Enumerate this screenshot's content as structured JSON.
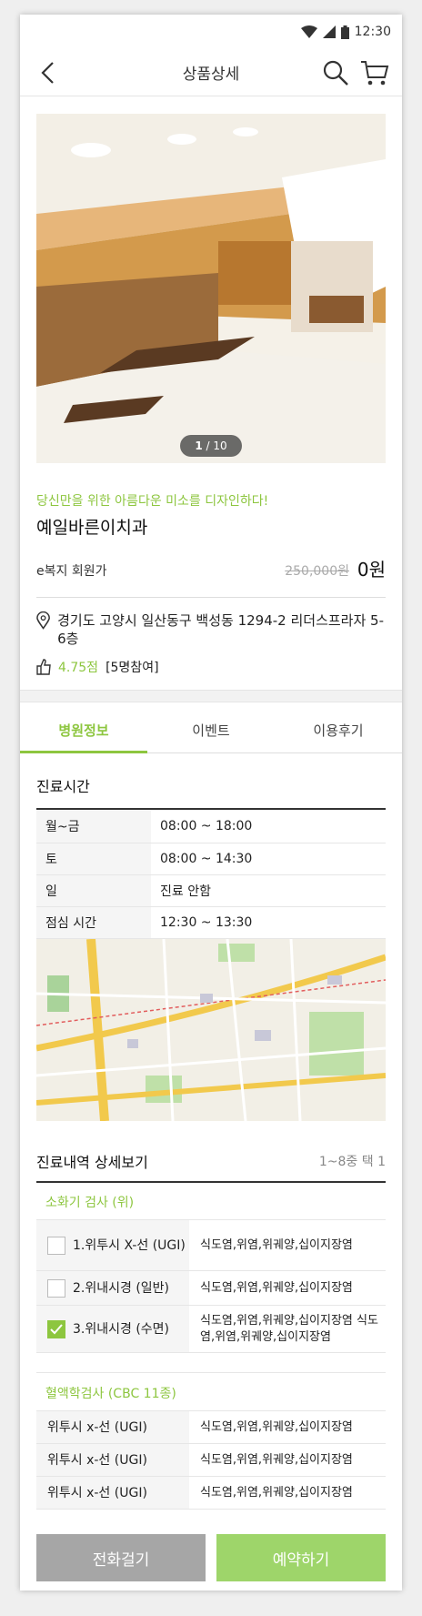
{
  "status": {
    "time": "12:30"
  },
  "appbar": {
    "title": "상품상세"
  },
  "gallery": {
    "pager_current": "1",
    "pager_total": "10"
  },
  "product": {
    "promo": "당신만을 위한 아름다운 미소를 디자인하다!",
    "name": "예일바른이치과",
    "member_label": "e복지 회원가",
    "original_price": "250,000원",
    "price": "0원",
    "address": "경기도 고양시 일산동구 백성동 1294-2 리더스프라자 5-6층",
    "rating_score": "4.75점",
    "rating_count": "[5명참여]"
  },
  "tabs": [
    {
      "label": "병원정보"
    },
    {
      "label": "이벤트"
    },
    {
      "label": "이용후기"
    }
  ],
  "hours": {
    "title": "진료시간",
    "rows": [
      {
        "day": "월~금",
        "time": "08:00 ~ 18:00"
      },
      {
        "day": "토",
        "time": "08:00 ~ 14:30"
      },
      {
        "day": "일",
        "time": "진료 안함"
      },
      {
        "day": "점심 시간",
        "time": "12:30 ~ 13:30"
      }
    ]
  },
  "details": {
    "title": "진료내역 상세보기",
    "count": "1~8중 택 1",
    "category1": "소화기 검사 (위)",
    "items1": [
      {
        "name": "1.위투시 X-선 (UGI)",
        "desc": "식도염,위염,위궤양,십이지장염",
        "checked": false
      },
      {
        "name": "2.위내시경 (일반)",
        "desc": "식도염,위염,위궤양,십이지장염",
        "checked": false
      },
      {
        "name": "3.위내시경 (수면)",
        "desc": "식도염,위염,위궤양,십이지장염 식도염,위염,위궤양,십이지장염",
        "checked": true
      }
    ],
    "category2": "혈액학검사 (CBC 11종)",
    "items2": [
      {
        "name": "위투시 x-선 (UGI)",
        "desc": "식도염,위염,위궤양,십이지장염"
      },
      {
        "name": "위투시 x-선 (UGI)",
        "desc": "식도염,위염,위궤양,십이지장염"
      },
      {
        "name": "위투시 x-선 (UGI)",
        "desc": "식도염,위염,위궤양,십이지장염"
      }
    ]
  },
  "actions": {
    "call": "전화걸기",
    "reserve": "예약하기"
  },
  "colors": {
    "accent": "#8dc63f",
    "reserve_button": "#9ed56a",
    "call_button": "#a6a6a6"
  }
}
